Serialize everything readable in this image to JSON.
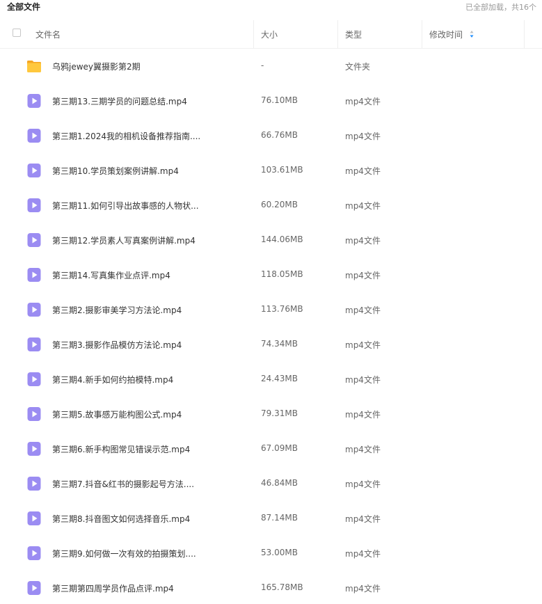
{
  "breadcrumb": "全部文件",
  "status": "已全部加载，共16个",
  "columns": {
    "name": "文件名",
    "size": "大小",
    "type": "类型",
    "modified": "修改时间"
  },
  "colors": {
    "folder": "#FFC83D",
    "video": "#9B8CF2"
  },
  "files": [
    {
      "name": "乌鸦jewey翼摄影第2期",
      "size": "-",
      "type": "文件夹",
      "icon": "folder-icon"
    },
    {
      "name": "第三期13.三期学员的问题总结.mp4",
      "size": "76.10MB",
      "type": "mp4文件",
      "icon": "video-file-icon"
    },
    {
      "name": "第三期1.2024我的相机设备推荐指南....",
      "size": "66.76MB",
      "type": "mp4文件",
      "icon": "video-file-icon"
    },
    {
      "name": "第三期10.学员策划案例讲解.mp4",
      "size": "103.61MB",
      "type": "mp4文件",
      "icon": "video-file-icon"
    },
    {
      "name": "第三期11.如何引导出故事感的人物状...",
      "size": "60.20MB",
      "type": "mp4文件",
      "icon": "video-file-icon"
    },
    {
      "name": "第三期12.学员素人写真案例讲解.mp4",
      "size": "144.06MB",
      "type": "mp4文件",
      "icon": "video-file-icon"
    },
    {
      "name": "第三期14.写真集作业点评.mp4",
      "size": "118.05MB",
      "type": "mp4文件",
      "icon": "video-file-icon"
    },
    {
      "name": "第三期2.摄影审美学习方法论.mp4",
      "size": "113.76MB",
      "type": "mp4文件",
      "icon": "video-file-icon"
    },
    {
      "name": "第三期3.摄影作品模仿方法论.mp4",
      "size": "74.34MB",
      "type": "mp4文件",
      "icon": "video-file-icon"
    },
    {
      "name": "第三期4.新手如何约拍模特.mp4",
      "size": "24.43MB",
      "type": "mp4文件",
      "icon": "video-file-icon"
    },
    {
      "name": "第三期5.故事感万能构图公式.mp4",
      "size": "79.31MB",
      "type": "mp4文件",
      "icon": "video-file-icon"
    },
    {
      "name": "第三期6.新手构图常见错误示范.mp4",
      "size": "67.09MB",
      "type": "mp4文件",
      "icon": "video-file-icon"
    },
    {
      "name": "第三期7.抖音&红书的摄影起号方法....",
      "size": "46.84MB",
      "type": "mp4文件",
      "icon": "video-file-icon"
    },
    {
      "name": "第三期8.抖音图文如何选择音乐.mp4",
      "size": "87.14MB",
      "type": "mp4文件",
      "icon": "video-file-icon"
    },
    {
      "name": "第三期9.如何做一次有效的拍摄策划....",
      "size": "53.00MB",
      "type": "mp4文件",
      "icon": "video-file-icon"
    },
    {
      "name": "第三期第四周学员作品点评.mp4",
      "size": "165.78MB",
      "type": "mp4文件",
      "icon": "video-file-icon"
    }
  ]
}
